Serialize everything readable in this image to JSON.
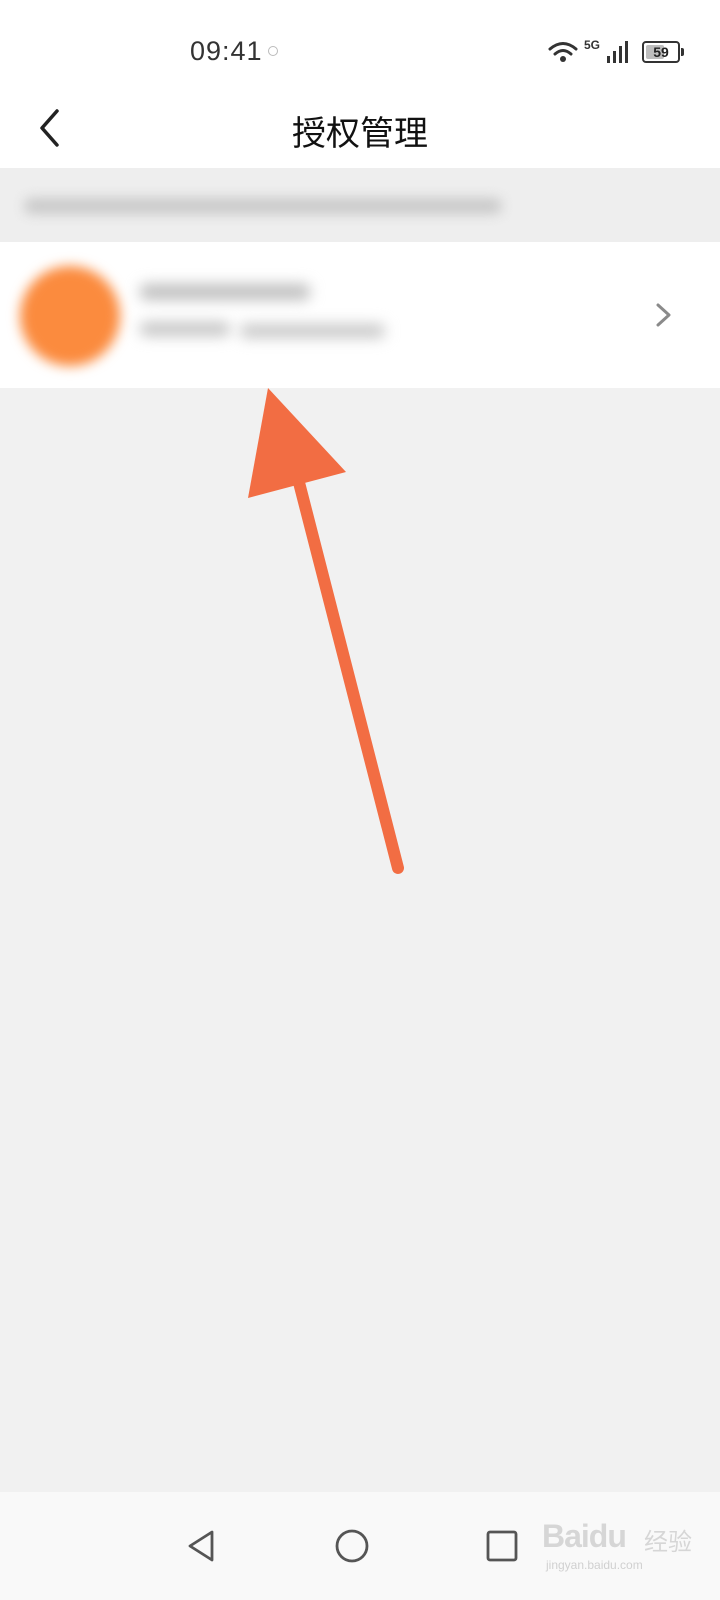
{
  "status_bar": {
    "time": "09:41",
    "network": "5G",
    "battery": {
      "level": 59,
      "label": "59"
    }
  },
  "header": {
    "title": "授权管理",
    "back_icon": "chevron-left-icon"
  },
  "list": {
    "items": [
      {
        "avatar_color": "#fb8b3e",
        "chevron_icon": "chevron-right-icon"
      }
    ]
  },
  "annotation": {
    "arrow_color": "#f26d43"
  },
  "nav_bar": {
    "back_icon": "triangle-back-icon",
    "home_icon": "circle-home-icon",
    "recents_icon": "square-recents-icon"
  },
  "watermark": {
    "brand": "Baidu",
    "suffix": "经验",
    "url": "jingyan.baidu.com"
  }
}
